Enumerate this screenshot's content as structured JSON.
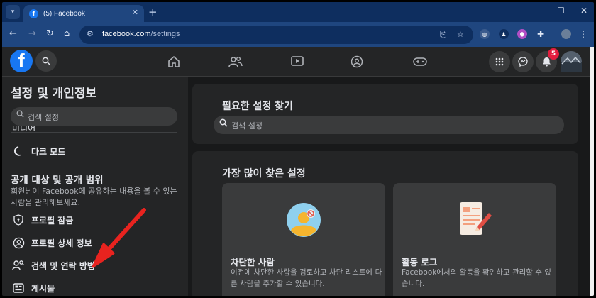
{
  "browser": {
    "tab_count_label": "(5) Facebook",
    "tab_close": "✕",
    "new_tab": "+",
    "url_host": "facebook.com",
    "url_path": "/settings",
    "window_controls": [
      "—",
      "☐",
      "✕"
    ]
  },
  "topbar": {
    "notifications_badge": "5",
    "nav_icons": [
      "home-icon",
      "friends-icon",
      "video-icon",
      "groups-icon",
      "gaming-icon"
    ],
    "right_icons": [
      "menu-grid-icon",
      "messenger-icon",
      "bell-icon",
      "avatar"
    ]
  },
  "sidebar": {
    "title": "설정 및 개인정보",
    "search_placeholder": "검색 설정",
    "cut_item": "미디어",
    "dark_mode": "다크 모드",
    "section_title": "공개 대상 및 공개 범위",
    "section_desc": "회원님이 Facebook에 공유하는 내용을 볼 수 있는 사람을 관리해보세요.",
    "items": [
      {
        "label": "프로필 잠금",
        "icon": "profile-lock-icon"
      },
      {
        "label": "프로필 상세 정보",
        "icon": "profile-details-icon"
      },
      {
        "label": "검색 및 연락 방법",
        "icon": "search-contact-icon"
      },
      {
        "label": "게시물",
        "icon": "posts-icon"
      }
    ]
  },
  "main": {
    "find_title": "필요한 설정 찾기",
    "find_placeholder": "검색 설정",
    "popular_title": "가장 많이 찾은 설정",
    "tiles": [
      {
        "name": "차단한 사람",
        "desc": "이전에 차단한 사람을 검토하고 차단 리스트에 다른 사람을 추가할 수 있습니다.",
        "icon": "blocked-user-icon"
      },
      {
        "name": "활동 로그",
        "desc": "Facebook에서의 활동을 확인하고 관리할 수 있습니다.",
        "icon": "activity-log-icon"
      }
    ]
  },
  "colors": {
    "fb_blue": "#1877f2",
    "badge_red": "#e41e3f",
    "arrow_red": "#e8231f",
    "chrome_dark": "#0e2e5f"
  }
}
